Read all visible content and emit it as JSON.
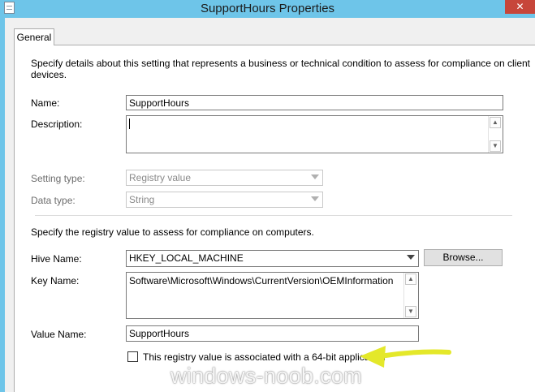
{
  "window": {
    "title": "SupportHours Properties",
    "close_glyph": "✕"
  },
  "tabs": [
    {
      "label": "General"
    }
  ],
  "general": {
    "intro": "Specify details about this setting that represents a business or technical condition to assess for compliance on client",
    "intro_cont": "devices.",
    "name_label": "Name:",
    "name_value": "SupportHours",
    "description_label": "Description:",
    "description_value": "",
    "setting_type_label": "Setting type:",
    "setting_type_value": "Registry value",
    "data_type_label": "Data type:",
    "data_type_value": "String",
    "registry_intro": "Specify the registry value to assess for compliance on computers.",
    "hive_label": "Hive Name:",
    "hive_value": "HKEY_LOCAL_MACHINE",
    "browse_label": "Browse...",
    "key_label": "Key Name:",
    "key_value": "Software\\Microsoft\\Windows\\CurrentVersion\\OEMInformation",
    "value_name_label": "Value Name:",
    "value_name_value": "SupportHours",
    "checkbox_label": "This registry value is associated with a 64-bit application",
    "checkbox_checked": false
  },
  "annotation": {
    "arrow_color": "#e4e82a",
    "watermark": "windows-noob.com"
  },
  "colors": {
    "titlebar": "#6ec5e9",
    "close_button": "#c7463a"
  }
}
